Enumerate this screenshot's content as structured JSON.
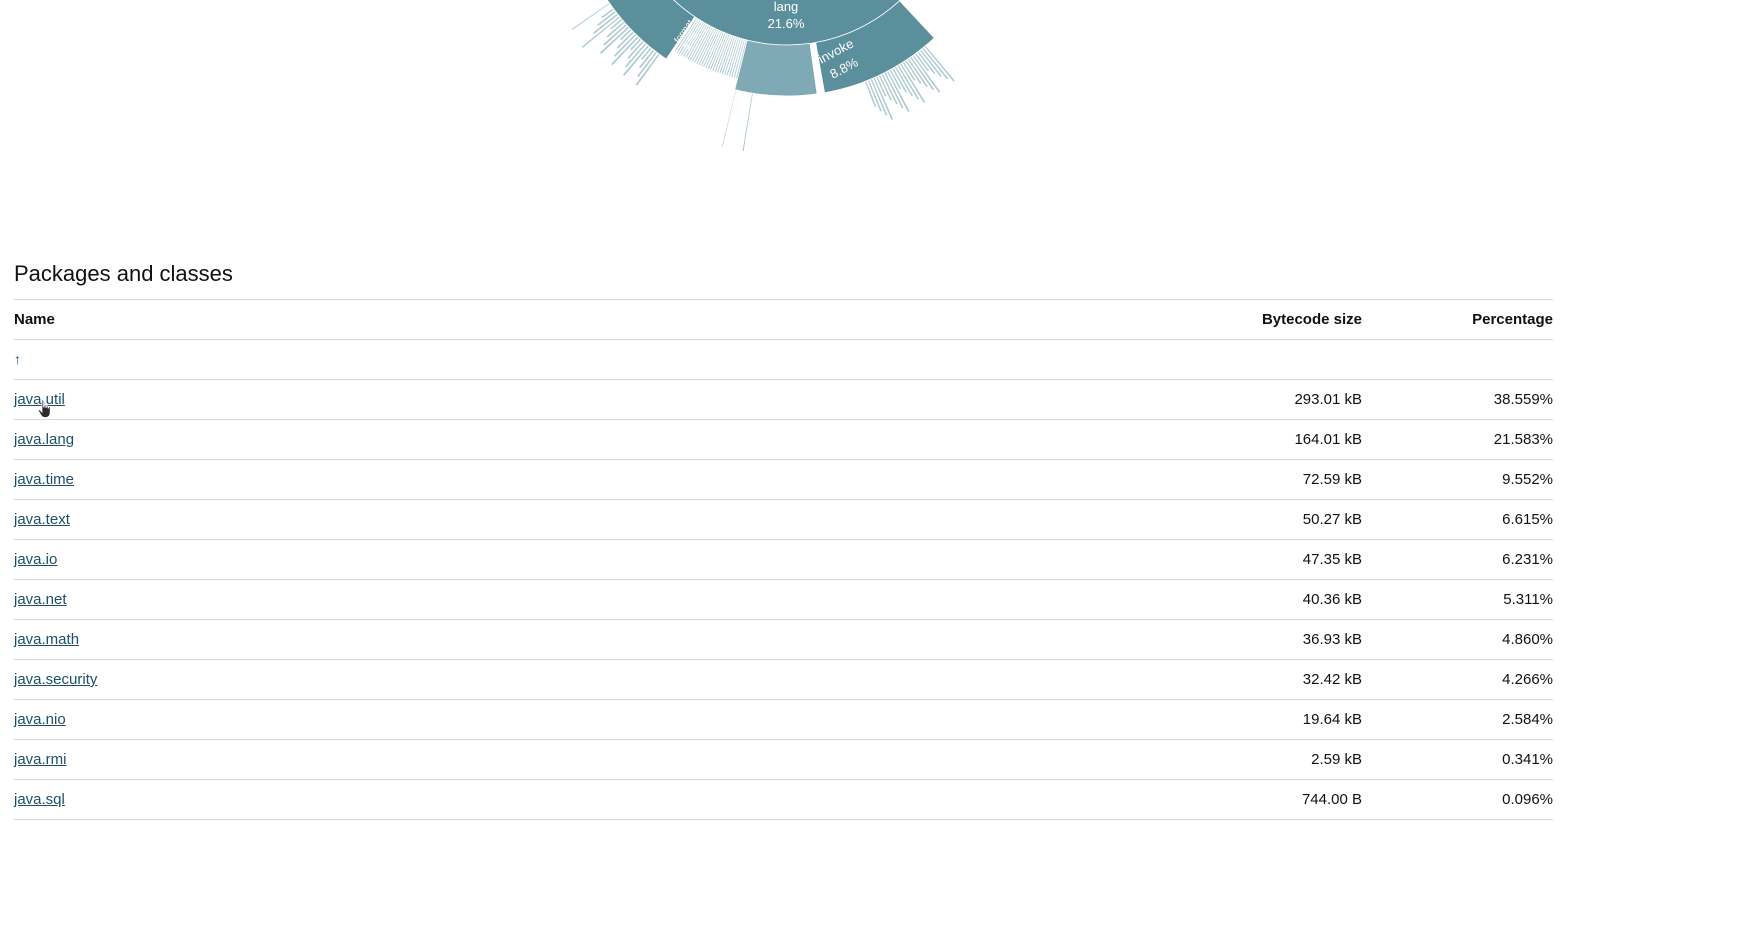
{
  "chart_data": {
    "type": "sunburst",
    "segments": [
      {
        "label": "lang",
        "value": "21.6%"
      },
      {
        "label": "invoke",
        "value": "8.8%"
      },
      {
        "label": "format",
        "value": "3.7%"
      }
    ]
  },
  "colors": {
    "link": "#1b4f6b",
    "ring_dark": "#5b8f9b",
    "ring_mid": "#7faab5",
    "ring_light": "#aecbd2",
    "border": "#d9d9d9"
  },
  "section": {
    "title": "Packages and classes"
  },
  "table": {
    "headers": {
      "name": "Name",
      "size": "Bytecode size",
      "percentage": "Percentage"
    },
    "up_link": "↑",
    "rows": [
      {
        "name": "java.util",
        "size": "293.01 kB",
        "percentage": "38.559%"
      },
      {
        "name": "java.lang",
        "size": "164.01 kB",
        "percentage": "21.583%"
      },
      {
        "name": "java.time",
        "size": "72.59 kB",
        "percentage": "9.552%"
      },
      {
        "name": "java.text",
        "size": "50.27 kB",
        "percentage": "6.615%"
      },
      {
        "name": "java.io",
        "size": "47.35 kB",
        "percentage": "6.231%"
      },
      {
        "name": "java.net",
        "size": "40.36 kB",
        "percentage": "5.311%"
      },
      {
        "name": "java.math",
        "size": "36.93 kB",
        "percentage": "4.860%"
      },
      {
        "name": "java.security",
        "size": "32.42 kB",
        "percentage": "4.266%"
      },
      {
        "name": "java.nio",
        "size": "19.64 kB",
        "percentage": "2.584%"
      },
      {
        "name": "java.rmi",
        "size": "2.59 kB",
        "percentage": "0.341%"
      },
      {
        "name": "java.sql",
        "size": "744.00 B",
        "percentage": "0.096%"
      }
    ]
  },
  "cursor": {
    "icon": "hand-pointer-icon"
  }
}
